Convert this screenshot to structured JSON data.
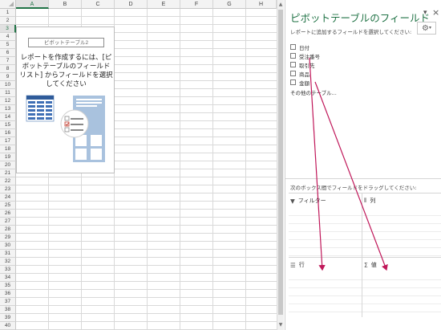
{
  "sheet": {
    "columns": [
      "A",
      "B",
      "C",
      "D",
      "E",
      "F",
      "G",
      "H"
    ],
    "active_column": "A",
    "rows": [
      "1",
      "2",
      "3",
      "4",
      "5",
      "6",
      "7",
      "8",
      "9",
      "10",
      "11",
      "12",
      "13",
      "14",
      "15",
      "16",
      "17",
      "18",
      "19",
      "20",
      "21",
      "22",
      "23",
      "24",
      "25",
      "26",
      "27",
      "28",
      "29",
      "30",
      "31",
      "32",
      "33",
      "34",
      "35",
      "36",
      "37",
      "38",
      "39",
      "40"
    ],
    "active_row": "3",
    "pivot_placeholder": {
      "name": "ピボットテーブル2",
      "message": "レポートを作成するには、[ピボットテーブルのフィールド リスト] からフィールドを選択してください"
    }
  },
  "pane": {
    "title": "ピボットテーブルのフィールド",
    "instruction": "レポートに追加するフィールドを選択してください:",
    "gear_icon": "gear-icon",
    "fields": [
      {
        "label": "日付",
        "checked": false
      },
      {
        "label": "受注番号",
        "checked": false
      },
      {
        "label": "取引先",
        "checked": false
      },
      {
        "label": "商品",
        "checked": false
      },
      {
        "label": "金額",
        "checked": false
      }
    ],
    "more_tables": "その他のテーブル...",
    "drag_instruction": "次のボックス間でフィールドをドラッグしてください:",
    "areas": {
      "filter": "フィルター",
      "columns": "列",
      "rows": "行",
      "values": "値"
    }
  },
  "colors": {
    "accent": "#217346",
    "annotation_arrow": "#c0185a"
  }
}
